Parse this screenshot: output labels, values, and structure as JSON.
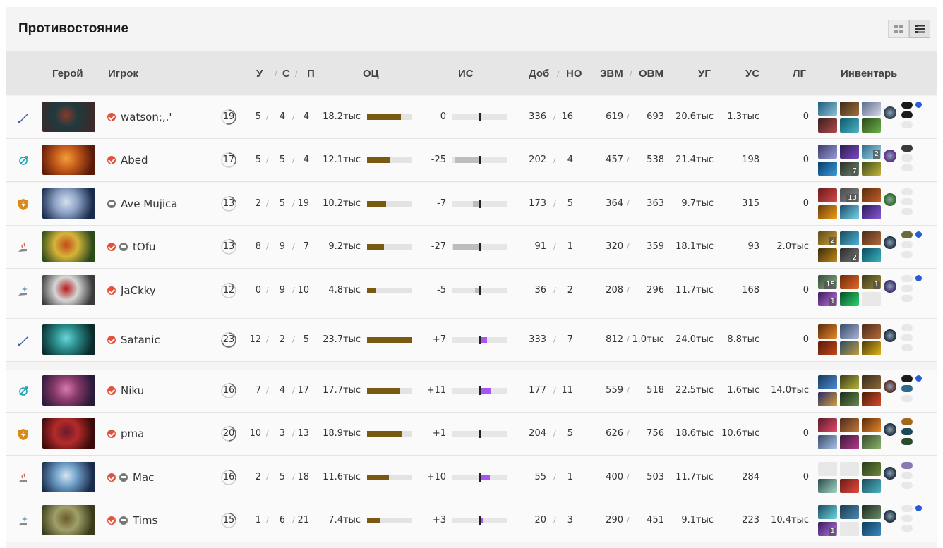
{
  "title": "Противостояние",
  "view_buttons": {
    "grid_icon": "grid-view-icon",
    "list_icon": "list-view-icon"
  },
  "headers": {
    "hero": "Герой",
    "player": "Игрок",
    "kills": "У",
    "deaths": "С",
    "assists": "П",
    "net": "ОЦ",
    "xp_adv": "ИС",
    "lh": "Доб",
    "dn": "НО",
    "gpm": "ЗВМ",
    "xpm": "ОВМ",
    "hd": "УГ",
    "td": "УС",
    "heal": "ЛГ",
    "inventory": "Инвентарь",
    "sep": "/"
  },
  "colors": {
    "net_bar": "#7a5a12",
    "xp_pos": "#a855f7",
    "xp_neg": "#bdbdbd",
    "radiant": [
      "#2d6a9c",
      "#1aa3b5",
      "#d98a1c",
      "#e06a4a",
      "#6aa5b8"
    ],
    "accent_check": "#e4503a"
  },
  "players": [
    {
      "role": "carry-role-icon",
      "hero": "hero-portrait",
      "heroColors": [
        "#3a2a2a",
        "#1f3a3f",
        "#8a3a2a"
      ],
      "name": "watson;,.'",
      "verified": true,
      "bot": false,
      "level": "19",
      "levelFrac": 0.55,
      "k": "5",
      "d": "4",
      "a": "4",
      "net": "18.2тыс",
      "netFrac": 0.75,
      "ia": "0",
      "iaFrac": 0,
      "lh": "336",
      "dn": "16",
      "gpm": "619",
      "xpm": "693",
      "hd": "20.6тыс",
      "td": "1.3тыс",
      "heal": "0",
      "items": [
        {
          "c": [
            "#1c5a7a",
            "#8fc1d6"
          ],
          "n": ""
        },
        {
          "c": [
            "#3b2a1a",
            "#a0703a"
          ],
          "n": ""
        },
        {
          "c": [
            "#5a6a8a",
            "#d6d6e6"
          ],
          "n": ""
        },
        {
          "c": [
            "#3a1f1f",
            "#b24a4a"
          ],
          "n": ""
        },
        {
          "c": [
            "#0e5a6a",
            "#4fb3c4"
          ],
          "n": ""
        },
        {
          "c": [
            "#2a4a1a",
            "#6ab04a"
          ],
          "n": ""
        }
      ],
      "neutral": "#2a3a4a",
      "bp": [
        "#1a1a1a",
        "#1a1a1a",
        "#e8e8e8"
      ],
      "dot": true
    },
    {
      "role": "support-role-icon",
      "hero": "hero-portrait",
      "heroColors": [
        "#5a1a0a",
        "#c45a1a",
        "#f2a03a"
      ],
      "name": "Abed",
      "verified": true,
      "bot": false,
      "level": "17",
      "levelFrac": 0.35,
      "k": "5",
      "d": "5",
      "a": "4",
      "net": "12.1тыс",
      "netFrac": 0.5,
      "ia": "-25",
      "iaFrac": -0.92,
      "lh": "202",
      "dn": "4",
      "gpm": "457",
      "xpm": "538",
      "hd": "21.4тыс",
      "td": "198",
      "heal": "0",
      "items": [
        {
          "c": [
            "#3a3a6a",
            "#9a9ad6"
          ],
          "n": ""
        },
        {
          "c": [
            "#2a1a4a",
            "#7a4ac4"
          ],
          "n": ""
        },
        {
          "c": [
            "#2a6a8a",
            "#a6d6e6"
          ],
          "n": "2"
        },
        {
          "c": [
            "#0a3a6a",
            "#3a9ad6"
          ],
          "n": ""
        },
        {
          "c": [
            "#2a2a2a",
            "#6a8a6a"
          ],
          "n": "7"
        },
        {
          "c": [
            "#3a4a1a",
            "#c4b43a"
          ],
          "n": ""
        }
      ],
      "neutral": "#5a2a8a",
      "bp": [
        "#3a3a3a",
        "#e8e8e8",
        "#e8e8e8"
      ],
      "dot": false
    },
    {
      "role": "offlane-role-icon",
      "hero": "hero-portrait",
      "heroColors": [
        "#1a2a4a",
        "#8aa0c4",
        "#d6e0ee"
      ],
      "name": "Ave Mujica",
      "verified": false,
      "bot": true,
      "level": "13",
      "levelFrac": 0.2,
      "k": "2",
      "d": "5",
      "a": "19",
      "net": "10.2тыс",
      "netFrac": 0.42,
      "ia": "-7",
      "iaFrac": -0.26,
      "lh": "173",
      "dn": "5",
      "gpm": "364",
      "xpm": "363",
      "hd": "9.7тыс",
      "td": "315",
      "heal": "0",
      "items": [
        {
          "c": [
            "#6a1a1a",
            "#d64a4a"
          ],
          "n": ""
        },
        {
          "c": [
            "#4a4a4a",
            "#8a8a8a"
          ],
          "n": "13"
        },
        {
          "c": [
            "#5a2a0a",
            "#c4602a"
          ],
          "n": ""
        },
        {
          "c": [
            "#6a3a0a",
            "#f2a01a"
          ],
          "n": ""
        },
        {
          "c": [
            "#1a4a6a",
            "#7ad6e6"
          ],
          "n": ""
        },
        {
          "c": [
            "#2a1a5a",
            "#8a5ad6"
          ],
          "n": ""
        }
      ],
      "neutral": "#2a6a1a",
      "bp": [
        "#e8e8e8",
        "#e8e8e8",
        "#e8e8e8"
      ],
      "dot": false
    },
    {
      "role": "softsupport-role-icon",
      "hero": "hero-portrait",
      "heroColors": [
        "#2a4a1a",
        "#d6b43a",
        "#c44a1a"
      ],
      "name": "tOfu",
      "verified": true,
      "bot": true,
      "level": "13",
      "levelFrac": 0.2,
      "k": "8",
      "d": "9",
      "a": "7",
      "net": "9.2тыс",
      "netFrac": 0.38,
      "ia": "-27",
      "iaFrac": -1.0,
      "lh": "91",
      "dn": "1",
      "gpm": "320",
      "xpm": "359",
      "hd": "18.1тыс",
      "td": "93",
      "heal": "2.0тыс",
      "items": [
        {
          "c": [
            "#5a4a1a",
            "#d6a03a"
          ],
          "n": "2"
        },
        {
          "c": [
            "#1a4a5a",
            "#4ab4d6"
          ],
          "n": ""
        },
        {
          "c": [
            "#4a2a1a",
            "#b46a3a"
          ],
          "n": ""
        },
        {
          "c": [
            "#3a2a0a",
            "#c48a1a"
          ],
          "n": ""
        },
        {
          "c": [
            "#2a2a2a",
            "#7a7a7a"
          ],
          "n": "2"
        },
        {
          "c": [
            "#0a4a5a",
            "#3ab4c4"
          ],
          "n": ""
        }
      ],
      "neutral": "#1a2a3a",
      "bp": [
        "#6a6a3a",
        "#e8e8e8",
        "#e8e8e8"
      ],
      "dot": true
    },
    {
      "role": "hardsupport-role-icon",
      "hero": "hero-portrait",
      "heroColors": [
        "#3a3a3a",
        "#d6d6d6",
        "#b41a1a"
      ],
      "name": "JaCkky",
      "verified": true,
      "bot": false,
      "level": "12",
      "levelFrac": 0.15,
      "k": "0",
      "d": "9",
      "a": "10",
      "net": "4.8тыс",
      "netFrac": 0.2,
      "ia": "-5",
      "iaFrac": -0.18,
      "lh": "36",
      "dn": "2",
      "gpm": "208",
      "xpm": "296",
      "hd": "11.7тыс",
      "td": "168",
      "heal": "0",
      "items": [
        {
          "c": [
            "#3a4a3a",
            "#8ab48a"
          ],
          "n": "15"
        },
        {
          "c": [
            "#6a2a0a",
            "#e66a2a"
          ],
          "n": ""
        },
        {
          "c": [
            "#3a3a1a",
            "#a08a3a"
          ],
          "n": "1"
        },
        {
          "c": [
            "#3a1a5a",
            "#c47ae6"
          ],
          "n": "1"
        },
        {
          "c": [
            "#0a4a2a",
            "#2ad66a"
          ],
          "n": ""
        },
        {
          "c": [
            "#e8e8e8",
            "#e8e8e8"
          ],
          "n": ""
        }
      ],
      "neutral": "#3a2a6a",
      "bp": [
        "#e8e8e8",
        "#e8e8e8",
        "#e8e8e8"
      ],
      "dot": true
    },
    {
      "role": "carry-role-icon",
      "hero": "hero-portrait",
      "heroColors": [
        "#0a2a2a",
        "#2a8a8a",
        "#6ad6d6"
      ],
      "name": "Satanic",
      "verified": true,
      "bot": false,
      "level": "23",
      "levelFrac": 0.75,
      "k": "12",
      "d": "2",
      "a": "5",
      "net": "23.7тыс",
      "netFrac": 0.98,
      "ia": "+7",
      "iaFrac": 0.26,
      "lh": "333",
      "dn": "7",
      "gpm": "812",
      "xpm": "1.0тыс",
      "hd": "24.0тыс",
      "td": "8.8тыс",
      "heal": "0",
      "items": [
        {
          "c": [
            "#5a2a0a",
            "#e6882a"
          ],
          "n": ""
        },
        {
          "c": [
            "#3a4a6a",
            "#a6b4d6"
          ],
          "n": ""
        },
        {
          "c": [
            "#4a2a1a",
            "#b46a3a"
          ],
          "n": ""
        },
        {
          "c": [
            "#5a1a0a",
            "#c44a1a"
          ],
          "n": ""
        },
        {
          "c": [
            "#2a4a6a",
            "#c4a03a"
          ],
          "n": ""
        },
        {
          "c": [
            "#4a3a0a",
            "#e6b41a"
          ],
          "n": ""
        }
      ],
      "neutral": "#1a2a3a",
      "bp": [
        "#e8e8e8",
        "#e8e8e8",
        "#e8e8e8"
      ],
      "dot": false
    },
    {
      "role": "support-role-icon",
      "hero": "hero-portrait",
      "heroColors": [
        "#2a1a3a",
        "#8a3a6a",
        "#d67ab4"
      ],
      "name": "Niku",
      "verified": true,
      "bot": false,
      "level": "16",
      "levelFrac": 0.3,
      "k": "7",
      "d": "4",
      "a": "17",
      "net": "17.7тыс",
      "netFrac": 0.72,
      "ia": "+11",
      "iaFrac": 0.42,
      "lh": "177",
      "dn": "11",
      "gpm": "559",
      "xpm": "518",
      "hd": "22.5тыс",
      "td": "1.6тыс",
      "heal": "14.0тыс",
      "items": [
        {
          "c": [
            "#1a3a5a",
            "#4a8ad6"
          ],
          "n": ""
        },
        {
          "c": [
            "#3a3a1a",
            "#b4b43a"
          ],
          "n": ""
        },
        {
          "c": [
            "#3a2a1a",
            "#8a6a3a"
          ],
          "n": ""
        },
        {
          "c": [
            "#2a2a6a",
            "#d6a03a"
          ],
          "n": ""
        },
        {
          "c": [
            "#1a2a1a",
            "#6a8a4a"
          ],
          "n": ""
        },
        {
          "c": [
            "#4a1a0a",
            "#d64a2a"
          ],
          "n": ""
        }
      ],
      "neutral": "#5a2a1a",
      "bp": [
        "#1a1a1a",
        "#2a6a8a",
        "#e8e8e8"
      ],
      "dot": true
    },
    {
      "role": "offlane-role-icon",
      "hero": "hero-portrait",
      "heroColors": [
        "#3a0a0a",
        "#b42a2a",
        "#6a1a2a"
      ],
      "name": "pma",
      "verified": true,
      "bot": false,
      "level": "20",
      "levelFrac": 0.5,
      "k": "10",
      "d": "3",
      "a": "13",
      "net": "18.9тыс",
      "netFrac": 0.78,
      "ia": "+1",
      "iaFrac": 0.05,
      "lh": "204",
      "dn": "5",
      "gpm": "626",
      "xpm": "756",
      "hd": "18.6тыс",
      "td": "10.6тыс",
      "heal": "0",
      "items": [
        {
          "c": [
            "#5a1a2a",
            "#e64a6a"
          ],
          "n": ""
        },
        {
          "c": [
            "#4a2a1a",
            "#c47a3a"
          ],
          "n": ""
        },
        {
          "c": [
            "#5a2a0a",
            "#e6882a"
          ],
          "n": ""
        },
        {
          "c": [
            "#3a4a6a",
            "#a6c4e6"
          ],
          "n": ""
        },
        {
          "c": [
            "#3a1a3a",
            "#b43a8a"
          ],
          "n": ""
        },
        {
          "c": [
            "#3a4a2a",
            "#8ab46a"
          ],
          "n": ""
        }
      ],
      "neutral": "#1a2a3a",
      "bp": [
        "#a06a1a",
        "#1a4a5a",
        "#2a4a2a"
      ],
      "dot": false
    },
    {
      "role": "softsupport-role-icon",
      "hero": "hero-portrait",
      "heroColors": [
        "#1a2a4a",
        "#6a9ac4",
        "#d6e6f2"
      ],
      "name": "Mac",
      "verified": true,
      "bot": true,
      "level": "16",
      "levelFrac": 0.3,
      "k": "2",
      "d": "5",
      "a": "18",
      "net": "11.6тыс",
      "netFrac": 0.48,
      "ia": "+10",
      "iaFrac": 0.38,
      "lh": "55",
      "dn": "1",
      "gpm": "400",
      "xpm": "503",
      "hd": "11.7тыс",
      "td": "284",
      "heal": "0",
      "items": [
        {
          "c": [
            "#e8e8e8",
            "#e8e8e8"
          ],
          "n": ""
        },
        {
          "c": [
            "#e8e8e8",
            "#e8e8e8"
          ],
          "n": ""
        },
        {
          "c": [
            "#2a3a1a",
            "#6a8a3a"
          ],
          "n": ""
        },
        {
          "c": [
            "#2a4a4a",
            "#a6d6c4"
          ],
          "n": ""
        },
        {
          "c": [
            "#6a1a1a",
            "#e64a3a"
          ],
          "n": ""
        },
        {
          "c": [
            "#1a4a5a",
            "#4ab4c4"
          ],
          "n": ""
        }
      ],
      "neutral": "#1a2a3a",
      "bp": [
        "#8a7ab4",
        "#e8e8e8",
        "#e8e8e8"
      ],
      "dot": false
    },
    {
      "role": "hardsupport-role-icon",
      "hero": "hero-portrait",
      "heroColors": [
        "#3a3a1a",
        "#a0a06a",
        "#6a5a2a"
      ],
      "name": "Tims",
      "verified": true,
      "bot": true,
      "level": "15",
      "levelFrac": 0.25,
      "k": "1",
      "d": "6",
      "a": "21",
      "net": "7.4тыс",
      "netFrac": 0.3,
      "ia": "+3",
      "iaFrac": 0.12,
      "lh": "20",
      "dn": "3",
      "gpm": "290",
      "xpm": "451",
      "hd": "9.1тыс",
      "td": "223",
      "heal": "10.4тыс",
      "items": [
        {
          "c": [
            "#1a4a5a",
            "#6ad6e6"
          ],
          "n": ""
        },
        {
          "c": [
            "#1a3a4a",
            "#4a8ab4"
          ],
          "n": ""
        },
        {
          "c": [
            "#1a2a1a",
            "#6a8a6a"
          ],
          "n": ""
        },
        {
          "c": [
            "#3a1a5a",
            "#b47ae6"
          ],
          "n": "1"
        },
        {
          "c": [
            "#e8e8e8",
            "#e8e8e8"
          ],
          "n": ""
        },
        {
          "c": [
            "#0a3a5a",
            "#3a8ac4"
          ],
          "n": ""
        }
      ],
      "neutral": "#1a2a3a",
      "bp": [
        "#e8e8e8",
        "#e8e8e8",
        "#e8e8e8"
      ],
      "dot": true
    }
  ]
}
